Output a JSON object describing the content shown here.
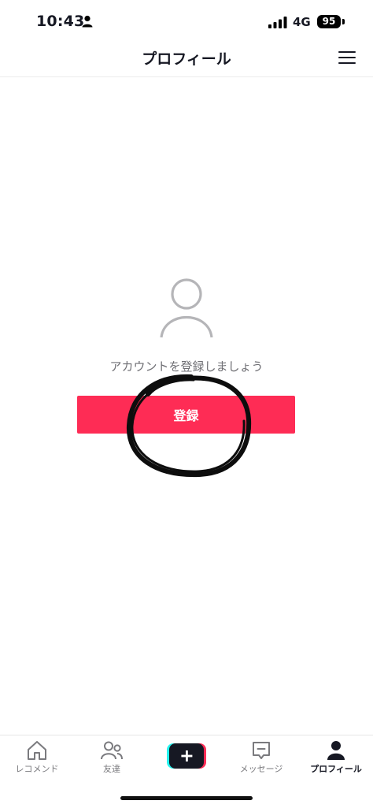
{
  "status_bar": {
    "time": "10:43",
    "network": "4G",
    "battery": "95"
  },
  "header": {
    "title": "プロフィール",
    "menu_icon": "hamburger-menu-icon"
  },
  "main": {
    "avatar_icon": "person-outline-icon",
    "prompt": "アカウントを登録しましょう",
    "register_label": "登録"
  },
  "tab_bar": {
    "items": [
      {
        "label": "レコメンド",
        "icon": "home-icon",
        "active": false
      },
      {
        "label": "友達",
        "icon": "friends-icon",
        "active": false
      },
      {
        "label": "",
        "icon": "create-plus-icon",
        "active": false
      },
      {
        "label": "メッセージ",
        "icon": "message-icon",
        "active": false
      },
      {
        "label": "プロフィール",
        "icon": "profile-icon",
        "active": true
      }
    ]
  },
  "colors": {
    "accent": "#fe2c55",
    "text": "#161823",
    "muted": "#6f6f74",
    "create_cyan": "#25f4ee",
    "create_red": "#fe2c55"
  }
}
